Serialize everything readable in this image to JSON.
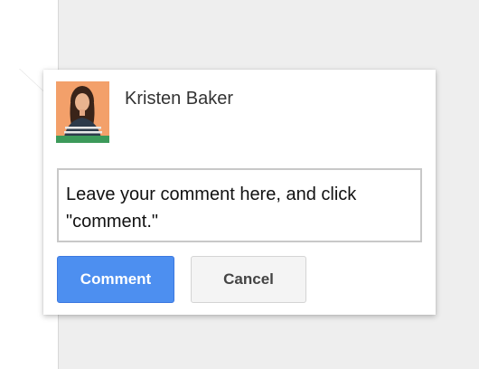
{
  "comment_card": {
    "author_name": "Kristen Baker",
    "avatar_icon": "user-avatar-photo",
    "comment_text": "Leave your comment here, and click \"comment.\"",
    "comment_button_label": "Comment",
    "cancel_button_label": "Cancel"
  },
  "colors": {
    "primary_button": "#4d8ff0",
    "secondary_button": "#f4f4f4",
    "avatar_background": "#f3a06a",
    "avatar_presence": "#3d9a5a",
    "backdrop": "#eeeeee"
  }
}
